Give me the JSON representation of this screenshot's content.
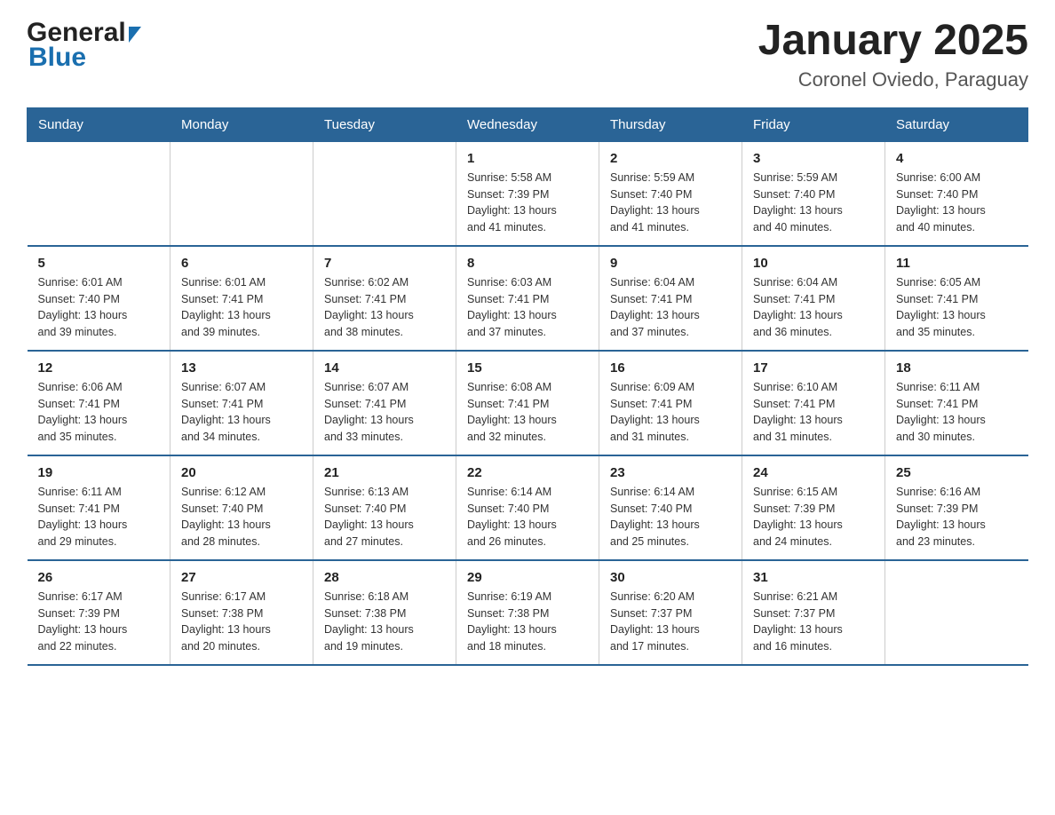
{
  "header": {
    "title": "January 2025",
    "subtitle": "Coronel Oviedo, Paraguay",
    "logo_general": "General",
    "logo_blue": "Blue"
  },
  "days_of_week": [
    "Sunday",
    "Monday",
    "Tuesday",
    "Wednesday",
    "Thursday",
    "Friday",
    "Saturday"
  ],
  "weeks": [
    [
      {
        "day": "",
        "info": ""
      },
      {
        "day": "",
        "info": ""
      },
      {
        "day": "",
        "info": ""
      },
      {
        "day": "1",
        "info": "Sunrise: 5:58 AM\nSunset: 7:39 PM\nDaylight: 13 hours\nand 41 minutes."
      },
      {
        "day": "2",
        "info": "Sunrise: 5:59 AM\nSunset: 7:40 PM\nDaylight: 13 hours\nand 41 minutes."
      },
      {
        "day": "3",
        "info": "Sunrise: 5:59 AM\nSunset: 7:40 PM\nDaylight: 13 hours\nand 40 minutes."
      },
      {
        "day": "4",
        "info": "Sunrise: 6:00 AM\nSunset: 7:40 PM\nDaylight: 13 hours\nand 40 minutes."
      }
    ],
    [
      {
        "day": "5",
        "info": "Sunrise: 6:01 AM\nSunset: 7:40 PM\nDaylight: 13 hours\nand 39 minutes."
      },
      {
        "day": "6",
        "info": "Sunrise: 6:01 AM\nSunset: 7:41 PM\nDaylight: 13 hours\nand 39 minutes."
      },
      {
        "day": "7",
        "info": "Sunrise: 6:02 AM\nSunset: 7:41 PM\nDaylight: 13 hours\nand 38 minutes."
      },
      {
        "day": "8",
        "info": "Sunrise: 6:03 AM\nSunset: 7:41 PM\nDaylight: 13 hours\nand 37 minutes."
      },
      {
        "day": "9",
        "info": "Sunrise: 6:04 AM\nSunset: 7:41 PM\nDaylight: 13 hours\nand 37 minutes."
      },
      {
        "day": "10",
        "info": "Sunrise: 6:04 AM\nSunset: 7:41 PM\nDaylight: 13 hours\nand 36 minutes."
      },
      {
        "day": "11",
        "info": "Sunrise: 6:05 AM\nSunset: 7:41 PM\nDaylight: 13 hours\nand 35 minutes."
      }
    ],
    [
      {
        "day": "12",
        "info": "Sunrise: 6:06 AM\nSunset: 7:41 PM\nDaylight: 13 hours\nand 35 minutes."
      },
      {
        "day": "13",
        "info": "Sunrise: 6:07 AM\nSunset: 7:41 PM\nDaylight: 13 hours\nand 34 minutes."
      },
      {
        "day": "14",
        "info": "Sunrise: 6:07 AM\nSunset: 7:41 PM\nDaylight: 13 hours\nand 33 minutes."
      },
      {
        "day": "15",
        "info": "Sunrise: 6:08 AM\nSunset: 7:41 PM\nDaylight: 13 hours\nand 32 minutes."
      },
      {
        "day": "16",
        "info": "Sunrise: 6:09 AM\nSunset: 7:41 PM\nDaylight: 13 hours\nand 31 minutes."
      },
      {
        "day": "17",
        "info": "Sunrise: 6:10 AM\nSunset: 7:41 PM\nDaylight: 13 hours\nand 31 minutes."
      },
      {
        "day": "18",
        "info": "Sunrise: 6:11 AM\nSunset: 7:41 PM\nDaylight: 13 hours\nand 30 minutes."
      }
    ],
    [
      {
        "day": "19",
        "info": "Sunrise: 6:11 AM\nSunset: 7:41 PM\nDaylight: 13 hours\nand 29 minutes."
      },
      {
        "day": "20",
        "info": "Sunrise: 6:12 AM\nSunset: 7:40 PM\nDaylight: 13 hours\nand 28 minutes."
      },
      {
        "day": "21",
        "info": "Sunrise: 6:13 AM\nSunset: 7:40 PM\nDaylight: 13 hours\nand 27 minutes."
      },
      {
        "day": "22",
        "info": "Sunrise: 6:14 AM\nSunset: 7:40 PM\nDaylight: 13 hours\nand 26 minutes."
      },
      {
        "day": "23",
        "info": "Sunrise: 6:14 AM\nSunset: 7:40 PM\nDaylight: 13 hours\nand 25 minutes."
      },
      {
        "day": "24",
        "info": "Sunrise: 6:15 AM\nSunset: 7:39 PM\nDaylight: 13 hours\nand 24 minutes."
      },
      {
        "day": "25",
        "info": "Sunrise: 6:16 AM\nSunset: 7:39 PM\nDaylight: 13 hours\nand 23 minutes."
      }
    ],
    [
      {
        "day": "26",
        "info": "Sunrise: 6:17 AM\nSunset: 7:39 PM\nDaylight: 13 hours\nand 22 minutes."
      },
      {
        "day": "27",
        "info": "Sunrise: 6:17 AM\nSunset: 7:38 PM\nDaylight: 13 hours\nand 20 minutes."
      },
      {
        "day": "28",
        "info": "Sunrise: 6:18 AM\nSunset: 7:38 PM\nDaylight: 13 hours\nand 19 minutes."
      },
      {
        "day": "29",
        "info": "Sunrise: 6:19 AM\nSunset: 7:38 PM\nDaylight: 13 hours\nand 18 minutes."
      },
      {
        "day": "30",
        "info": "Sunrise: 6:20 AM\nSunset: 7:37 PM\nDaylight: 13 hours\nand 17 minutes."
      },
      {
        "day": "31",
        "info": "Sunrise: 6:21 AM\nSunset: 7:37 PM\nDaylight: 13 hours\nand 16 minutes."
      },
      {
        "day": "",
        "info": ""
      }
    ]
  ]
}
